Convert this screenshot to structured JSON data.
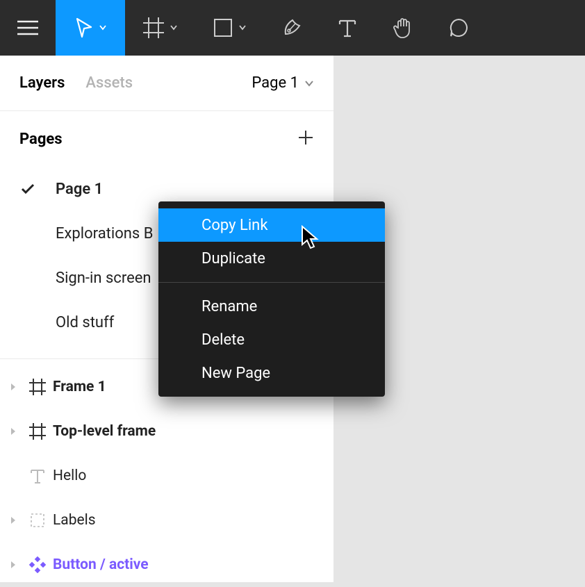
{
  "toolbar": {
    "tools": [
      "menu",
      "move",
      "frame",
      "shape",
      "pen",
      "text",
      "hand",
      "comment"
    ]
  },
  "sidebar": {
    "tabs": {
      "layers": "Layers",
      "assets": "Assets"
    },
    "page_switch": "Page 1",
    "pages_header": "Pages",
    "pages": [
      {
        "label": "Page 1",
        "current": true
      },
      {
        "label": "Explorations B",
        "current": false
      },
      {
        "label": "Sign-in screen",
        "current": false
      },
      {
        "label": "Old stuff",
        "current": false
      }
    ],
    "layers": [
      {
        "label": "Frame 1",
        "type": "frame",
        "bold": true,
        "disclosure": true
      },
      {
        "label": "Top-level frame",
        "type": "frame",
        "bold": true,
        "disclosure": true
      },
      {
        "label": "Hello",
        "type": "text",
        "bold": false,
        "disclosure": false
      },
      {
        "label": "Labels",
        "type": "group",
        "bold": false,
        "disclosure": true
      },
      {
        "label": "Button / active",
        "type": "component",
        "bold": true,
        "disclosure": true
      }
    ]
  },
  "context_menu": {
    "items_group1": [
      {
        "label": "Copy Link",
        "highlight": true
      },
      {
        "label": "Duplicate",
        "highlight": false
      }
    ],
    "items_group2": [
      {
        "label": "Rename"
      },
      {
        "label": "Delete"
      },
      {
        "label": "New Page"
      }
    ]
  }
}
